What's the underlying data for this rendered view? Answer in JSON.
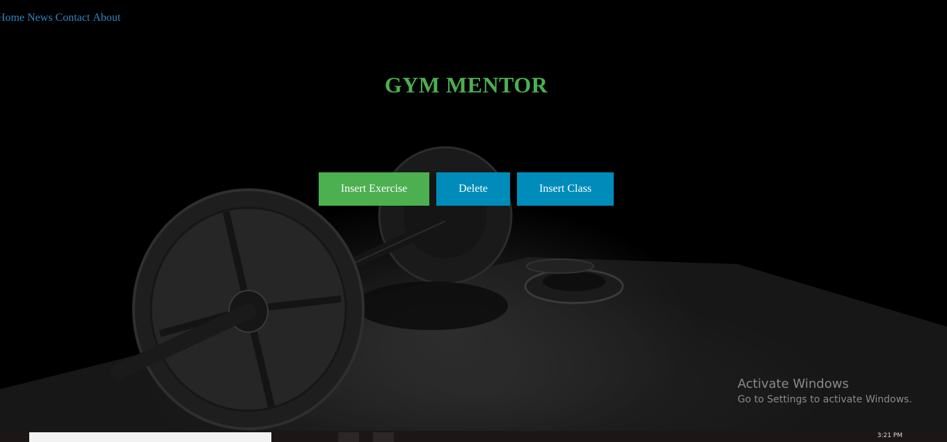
{
  "nav": {
    "items": [
      "Home",
      "News",
      "Contact",
      "About"
    ]
  },
  "header": {
    "title": "GYM MENTOR"
  },
  "actions": {
    "insert_exercise": "Insert Exercise",
    "delete": "Delete",
    "insert_class": "Insert Class"
  },
  "watermark": {
    "title": "Activate Windows",
    "subtitle": "Go to Settings to activate Windows."
  },
  "taskbar": {
    "clock": "3:21 PM"
  },
  "colors": {
    "title": "#4caf50",
    "primary_button": "#4caf50",
    "secondary_button": "#008cba",
    "nav_link": "#2e86c1",
    "background": "#000000"
  }
}
